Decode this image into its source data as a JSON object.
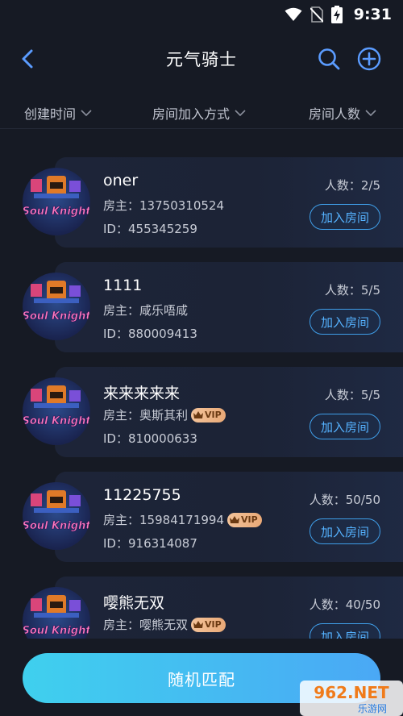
{
  "status_bar": {
    "time": "9:31"
  },
  "header": {
    "title": "元气骑士"
  },
  "filters": [
    {
      "label": "创建时间"
    },
    {
      "label": "房间加入方式"
    },
    {
      "label": "房间人数"
    }
  ],
  "rooms": [
    {
      "name": "oner",
      "owner_label": "房主：",
      "owner": "13750310524",
      "vip": false,
      "id_label": "ID：",
      "id": "455345259",
      "count_label": "人数：",
      "count": "2/5",
      "join_label": "加入房间",
      "avatar_text": "Soul Knight"
    },
    {
      "name": "1111",
      "owner_label": "房主：",
      "owner": "咸乐唔咸",
      "vip": false,
      "id_label": "ID：",
      "id": "880009413",
      "count_label": "人数：",
      "count": "5/5",
      "join_label": "加入房间",
      "avatar_text": "Soul Knight"
    },
    {
      "name": "来来来来来",
      "owner_label": "房主：",
      "owner": "奥斯其利",
      "vip": true,
      "vip_label": "VIP",
      "id_label": "ID：",
      "id": "810000633",
      "count_label": "人数：",
      "count": "5/5",
      "join_label": "加入房间",
      "avatar_text": "Soul Knight"
    },
    {
      "name": "11225755",
      "owner_label": "房主：",
      "owner": "15984171994",
      "vip": true,
      "vip_label": "VIP",
      "id_label": "ID：",
      "id": "916314087",
      "count_label": "人数：",
      "count": "50/50",
      "join_label": "加入房间",
      "avatar_text": "Soul Knight"
    },
    {
      "name": "嘤熊无双",
      "owner_label": "房主：",
      "owner": "嘤熊无双",
      "vip": true,
      "vip_label": "VIP",
      "id_label": "ID：",
      "id": "",
      "count_label": "人数：",
      "count": "40/50",
      "join_label": "加入房间",
      "avatar_text": "Soul Knight"
    }
  ],
  "random_match": {
    "label": "随机匹配"
  },
  "watermark": {
    "text_top": "962.NET",
    "text_bottom": "乐游网"
  },
  "colors": {
    "background": "#161a24",
    "accent": "#4aa8f5",
    "join_border": "#3f9ee8",
    "vip": "#e9a977"
  },
  "icons": [
    "wifi-icon",
    "no-sim-icon",
    "battery-charging-icon",
    "back-icon",
    "search-icon",
    "add-circle-icon",
    "chevron-down-icon",
    "crown-icon"
  ]
}
